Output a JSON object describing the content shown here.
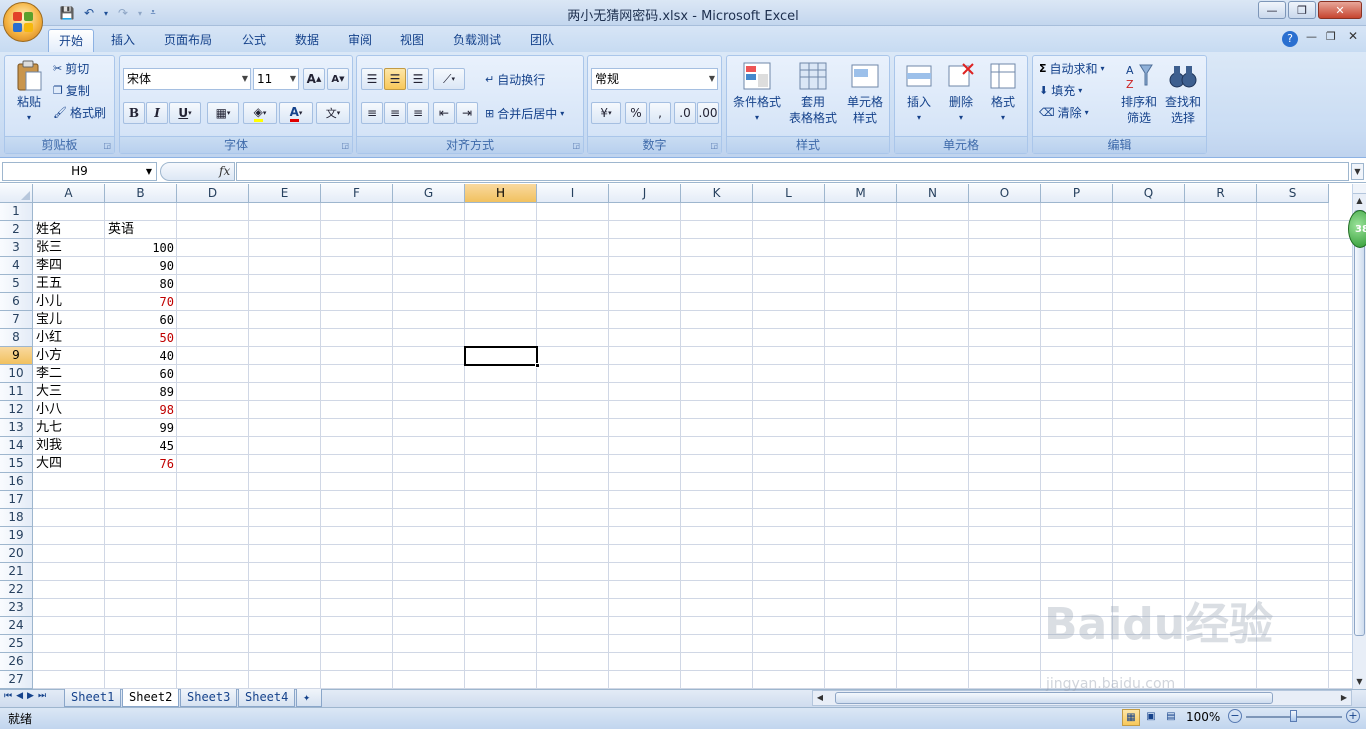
{
  "window": {
    "title": "两小无猜网密码.xlsx - Microsoft Excel"
  },
  "qat": {
    "undo_icon": "undo-icon",
    "redo_icon": "redo-icon",
    "save_icon": "save-icon"
  },
  "tabs": [
    {
      "label": "开始"
    },
    {
      "label": "插入"
    },
    {
      "label": "页面布局"
    },
    {
      "label": "公式"
    },
    {
      "label": "数据"
    },
    {
      "label": "审阅"
    },
    {
      "label": "视图"
    },
    {
      "label": "负载测试"
    },
    {
      "label": "团队"
    }
  ],
  "ribbon": {
    "clipboard": {
      "paste": "粘贴",
      "cut": "剪切",
      "copy": "复制",
      "format_painter": "格式刷",
      "group": "剪贴板"
    },
    "font": {
      "family": "宋体",
      "size": "11",
      "group": "字体"
    },
    "alignment": {
      "wrap": "自动换行",
      "merge": "合并后居中",
      "group": "对齐方式"
    },
    "number": {
      "format": "常规",
      "group": "数字"
    },
    "styles": {
      "conditional": "条件格式",
      "table_1": "套用",
      "table_2": "表格格式",
      "cell_1": "单元格",
      "cell_2": "样式",
      "group": "样式"
    },
    "cells": {
      "insert": "插入",
      "delete": "删除",
      "format": "格式",
      "group": "单元格"
    },
    "editing": {
      "autosum": "自动求和",
      "fill": "填充",
      "clear": "清除",
      "sort_1": "排序和",
      "sort_2": "筛选",
      "find_1": "查找和",
      "find_2": "选择",
      "group": "编辑"
    }
  },
  "formula_bar": {
    "name_box": "H9",
    "fx": "fx",
    "content": ""
  },
  "columns": [
    "A",
    "B",
    "D",
    "E",
    "F",
    "G",
    "H",
    "I",
    "J",
    "K",
    "L",
    "M",
    "N",
    "O",
    "P",
    "Q",
    "R",
    "S"
  ],
  "selected_column": "H",
  "rows": [
    "1",
    "2",
    "3",
    "4",
    "5",
    "6",
    "7",
    "8",
    "9",
    "10",
    "11",
    "12",
    "13",
    "14",
    "15",
    "16",
    "17",
    "18",
    "19",
    "20",
    "21",
    "22",
    "23",
    "24",
    "25",
    "26",
    "27"
  ],
  "selected_row": "9",
  "cells": {
    "header_name": "姓名",
    "header_score": "英语",
    "records": [
      {
        "name": "张三",
        "score": "100",
        "color": "#000000"
      },
      {
        "name": "李四",
        "score": "90",
        "color": "#000000"
      },
      {
        "name": "王五",
        "score": "80",
        "color": "#000000"
      },
      {
        "name": "小儿",
        "score": "70",
        "color": "#c00000"
      },
      {
        "name": "宝儿",
        "score": "60",
        "color": "#000000"
      },
      {
        "name": "小红",
        "score": "50",
        "color": "#c00000"
      },
      {
        "name": "小方",
        "score": "40",
        "color": "#000000"
      },
      {
        "name": "李二",
        "score": "60",
        "color": "#000000"
      },
      {
        "name": "大三",
        "score": "89",
        "color": "#000000"
      },
      {
        "name": "小八",
        "score": "98",
        "color": "#c00000"
      },
      {
        "name": "九七",
        "score": "99",
        "color": "#000000"
      },
      {
        "name": "刘我",
        "score": "45",
        "color": "#000000"
      },
      {
        "name": "大四",
        "score": "76",
        "color": "#c00000"
      }
    ]
  },
  "sheets": [
    {
      "label": "Sheet1"
    },
    {
      "label": "Sheet2"
    },
    {
      "label": "Sheet3"
    },
    {
      "label": "Sheet4"
    }
  ],
  "active_sheet": "Sheet2",
  "status": {
    "ready": "就绪",
    "zoom": "100%"
  },
  "watermark": {
    "main": "Baidu经验",
    "sub": "jingyan.baidu.com"
  },
  "badge": {
    "text": "38"
  }
}
